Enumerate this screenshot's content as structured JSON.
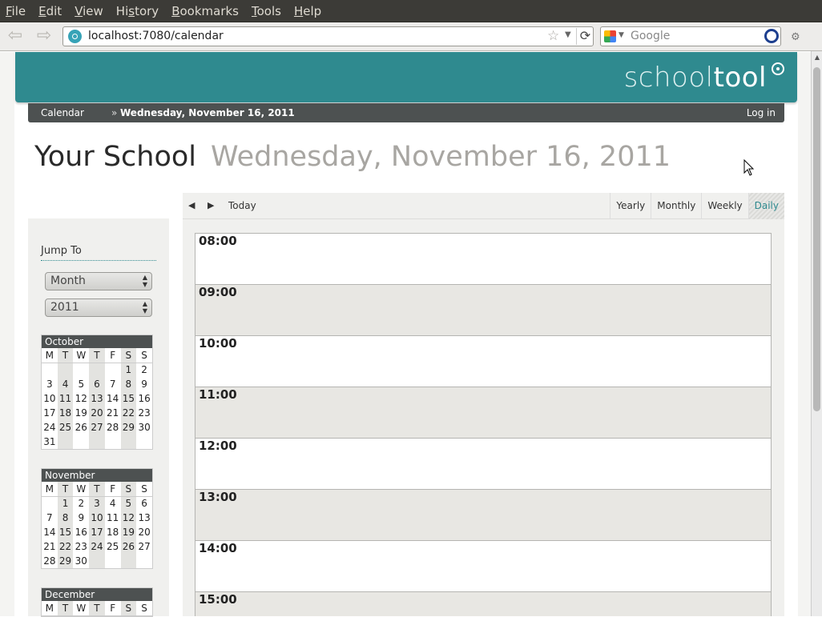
{
  "browser": {
    "menu": [
      "File",
      "Edit",
      "View",
      "History",
      "Bookmarks",
      "Tools",
      "Help"
    ],
    "menu_accel": [
      "F",
      "E",
      "V",
      "s",
      "B",
      "T",
      "H"
    ],
    "url": "localhost:7080/calendar",
    "search_placeholder": "Google"
  },
  "app": {
    "logo_light": "school",
    "logo_bold": "tool",
    "breadcrumb": {
      "root": "Calendar",
      "separator": "»",
      "current": "Wednesday, November 16, 2011"
    },
    "login": "Log in",
    "school_name": "Your School",
    "date_title": "Wednesday, November 16, 2011"
  },
  "sidebar": {
    "jump_label": "Jump To",
    "month_select": "Month",
    "year_select": "2011",
    "weekday_headers": [
      "M",
      "T",
      "W",
      "T",
      "F",
      "S",
      "S"
    ],
    "months": [
      {
        "name": "October",
        "weeks": [
          [
            "",
            "",
            "",
            "",
            "",
            "1",
            "2"
          ],
          [
            "3",
            "4",
            "5",
            "6",
            "7",
            "8",
            "9"
          ],
          [
            "10",
            "11",
            "12",
            "13",
            "14",
            "15",
            "16"
          ],
          [
            "17",
            "18",
            "19",
            "20",
            "21",
            "22",
            "23"
          ],
          [
            "24",
            "25",
            "26",
            "27",
            "28",
            "29",
            "30"
          ],
          [
            "31",
            "",
            "",
            "",
            "",
            "",
            ""
          ]
        ]
      },
      {
        "name": "November",
        "weeks": [
          [
            "",
            "1",
            "2",
            "3",
            "4",
            "5",
            "6"
          ],
          [
            "7",
            "8",
            "9",
            "10",
            "11",
            "12",
            "13"
          ],
          [
            "14",
            "15",
            "16",
            "17",
            "18",
            "19",
            "20"
          ],
          [
            "21",
            "22",
            "23",
            "24",
            "25",
            "26",
            "27"
          ],
          [
            "28",
            "29",
            "30",
            "",
            "",
            "",
            ""
          ]
        ]
      },
      {
        "name": "December",
        "weeks": []
      }
    ]
  },
  "toolbar": {
    "prev": "◀",
    "next": "▶",
    "today": "Today",
    "views": [
      "Yearly",
      "Monthly",
      "Weekly",
      "Daily"
    ],
    "active_view": "Daily"
  },
  "day": {
    "hours": [
      "08:00",
      "09:00",
      "10:00",
      "11:00",
      "12:00",
      "13:00",
      "14:00",
      "15:00"
    ]
  },
  "colors": {
    "brand": "#2f8a8f",
    "breadcrumb_bg": "#4d5151"
  }
}
